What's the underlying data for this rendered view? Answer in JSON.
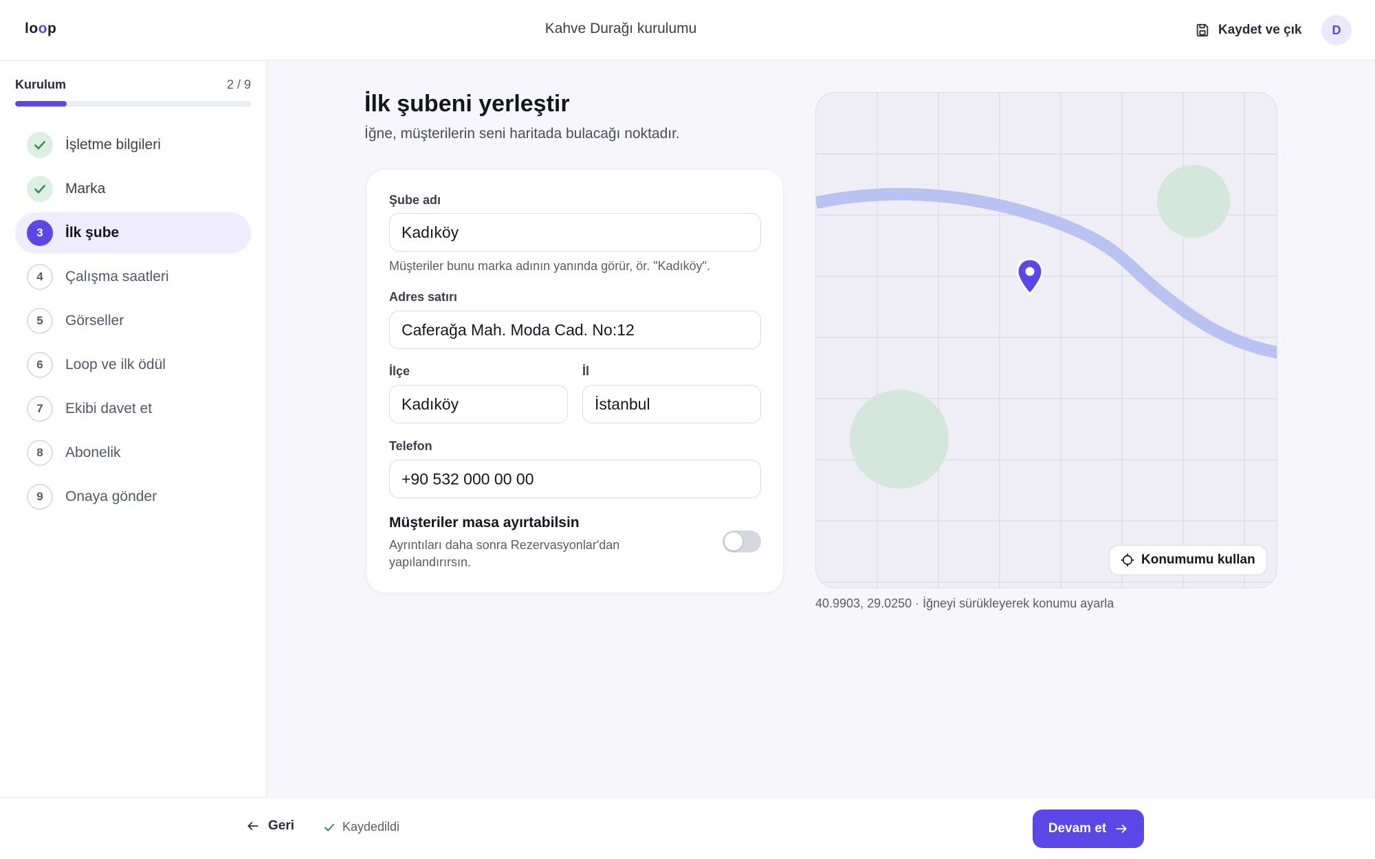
{
  "header": {
    "logo": {
      "pre": "lo",
      "mid": "o",
      "post": "p"
    },
    "title": "Kahve Durağı kurulumu",
    "save_exit_label": "Kaydet ve çık",
    "avatar_initial": "D"
  },
  "sidebar": {
    "label": "Kurulum",
    "counter": "2 / 9",
    "progress_fraction": 0.22,
    "steps": [
      {
        "number": "1",
        "label": "İşletme bilgileri",
        "status": "done"
      },
      {
        "number": "2",
        "label": "Marka",
        "status": "done"
      },
      {
        "number": "3",
        "label": "İlk şube",
        "status": "active"
      },
      {
        "number": "4",
        "label": "Çalışma saatleri",
        "status": "pending"
      },
      {
        "number": "5",
        "label": "Görseller",
        "status": "pending"
      },
      {
        "number": "6",
        "label": "Loop ve ilk ödül",
        "status": "pending"
      },
      {
        "number": "7",
        "label": "Ekibi davet et",
        "status": "pending"
      },
      {
        "number": "8",
        "label": "Abonelik",
        "status": "pending"
      },
      {
        "number": "9",
        "label": "Onaya gönder",
        "status": "pending"
      }
    ]
  },
  "main": {
    "title": "İlk şubeni yerleştir",
    "subtitle": "İğne, müşterilerin seni haritada bulacağı noktadır."
  },
  "form": {
    "branch_name": {
      "label": "Şube adı",
      "value": "Kadıköy",
      "help": "Müşteriler bunu marka adının yanında görür, ör. \"Kadıköy\"."
    },
    "address": {
      "label": "Adres satırı",
      "value": "Caferağa Mah. Moda Cad. No:12"
    },
    "district": {
      "label": "İlçe",
      "value": "Kadıköy"
    },
    "city": {
      "label": "İl",
      "value": "İstanbul"
    },
    "phone": {
      "label": "Telefon",
      "value": "+90 532 000 00 00"
    },
    "reservations": {
      "title": "Müşteriler masa ayırtabilsin",
      "description": "Ayrıntıları daha sonra Rezervasyonlar'dan yapılandırırsın.",
      "enabled": false
    }
  },
  "map": {
    "use_location_label": "Konumumu kullan",
    "coords_text": "40.9903, 29.0250 · İğneyi sürükleyerek konumu ayarla"
  },
  "footer": {
    "back_label": "Geri",
    "saved_label": "Kaydedildi",
    "next_label": "Devam et"
  },
  "colors": {
    "accent": "#5b47e8",
    "done_bg": "#dbefe3",
    "done_check": "#2f8a56",
    "road": "#b9c3f2",
    "park": "#d3e7dc"
  },
  "icons": {
    "save": "save-icon",
    "check": "check-icon",
    "map_pin": "map-pin-icon",
    "crosshair": "crosshair-icon",
    "arrow_left": "arrow-left-icon",
    "arrow_right": "arrow-right-icon"
  }
}
